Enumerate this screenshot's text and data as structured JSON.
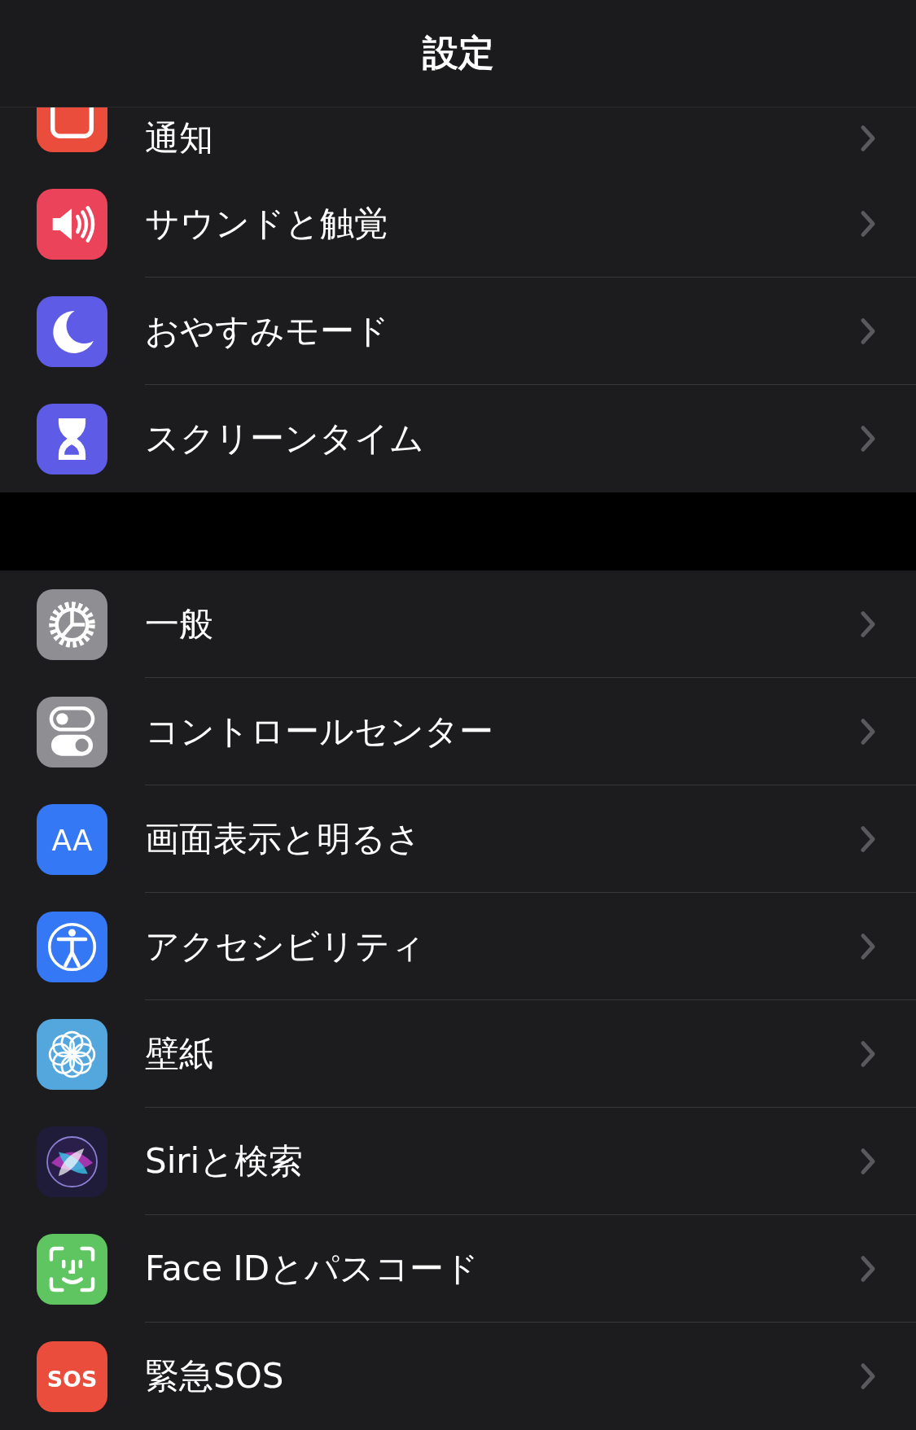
{
  "header": {
    "title": "設定"
  },
  "groups": [
    {
      "items": [
        {
          "label": "通知",
          "color": "#eb4d3d"
        },
        {
          "label": "サウンドと触覚",
          "color": "#eb445a"
        },
        {
          "label": "おやすみモード",
          "color": "#5e5ce6"
        },
        {
          "label": "スクリーンタイム",
          "color": "#5e5ce6"
        }
      ]
    },
    {
      "items": [
        {
          "label": "一般",
          "color": "#8e8e93"
        },
        {
          "label": "コントロールセンター",
          "color": "#8e8e93"
        },
        {
          "label": "画面表示と明るさ",
          "color": "#3478f6",
          "icon_text": "AA"
        },
        {
          "label": "アクセシビリティ",
          "color": "#3478f6"
        },
        {
          "label": "壁紙",
          "color": "#54a7dc"
        },
        {
          "label": "Siriと検索",
          "color": "#1f1c3a"
        },
        {
          "label": "Face IDとパスコード",
          "color": "#5fc560"
        },
        {
          "label": "緊急SOS",
          "color": "#eb4d3d",
          "icon_text": "SOS"
        }
      ]
    }
  ]
}
